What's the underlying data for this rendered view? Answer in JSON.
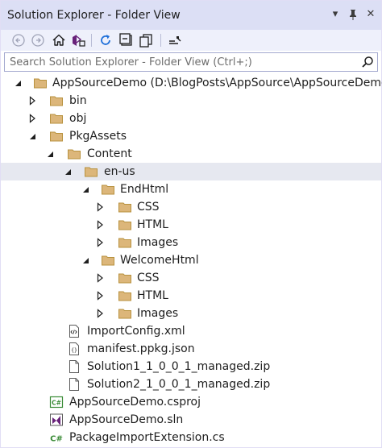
{
  "window": {
    "title": "Solution Explorer - Folder View",
    "dropdown_glyph": "▾",
    "pin_glyph": "ᛘ",
    "close_glyph": "✕"
  },
  "toolbar": {
    "icons": [
      "back-icon",
      "forward-icon",
      "home-icon",
      "switch-views-icon",
      "refresh-icon",
      "collapse-all-icon",
      "show-all-files-icon",
      "properties-icon"
    ]
  },
  "search": {
    "placeholder": "Search Solution Explorer - Folder View (Ctrl+;)",
    "value": ""
  },
  "tree": {
    "root": "AppSourceDemo (D:\\BlogPosts\\AppSource\\AppSourceDemo)",
    "bin": "bin",
    "obj": "obj",
    "pkgassets": "PkgAssets",
    "content": "Content",
    "enus": "en-us",
    "endhtml": "EndHtml",
    "end_css": "CSS",
    "end_html": "HTML",
    "end_images": "Images",
    "welcomehtml": "WelcomeHtml",
    "wel_css": "CSS",
    "wel_html": "HTML",
    "wel_images": "Images",
    "importconfig": "ImportConfig.xml",
    "manifest": "manifest.ppkg.json",
    "solution1": "Solution1_1_0_0_1_managed.zip",
    "solution2": "Solution2_1_0_0_1_managed.zip",
    "csproj": "AppSourceDemo.csproj",
    "sln": "AppSourceDemo.sln",
    "extension": "PackageImportExtension.cs",
    "selected_item": "en-us"
  },
  "colors": {
    "titlebar": "#dcdff5",
    "toolbar": "#eef0fb",
    "folder": "#dcb67a",
    "folder_dark": "#b8923f",
    "csharp": "#388a34",
    "vs_purple": "#68217a",
    "selection": "#e6e8f0"
  }
}
